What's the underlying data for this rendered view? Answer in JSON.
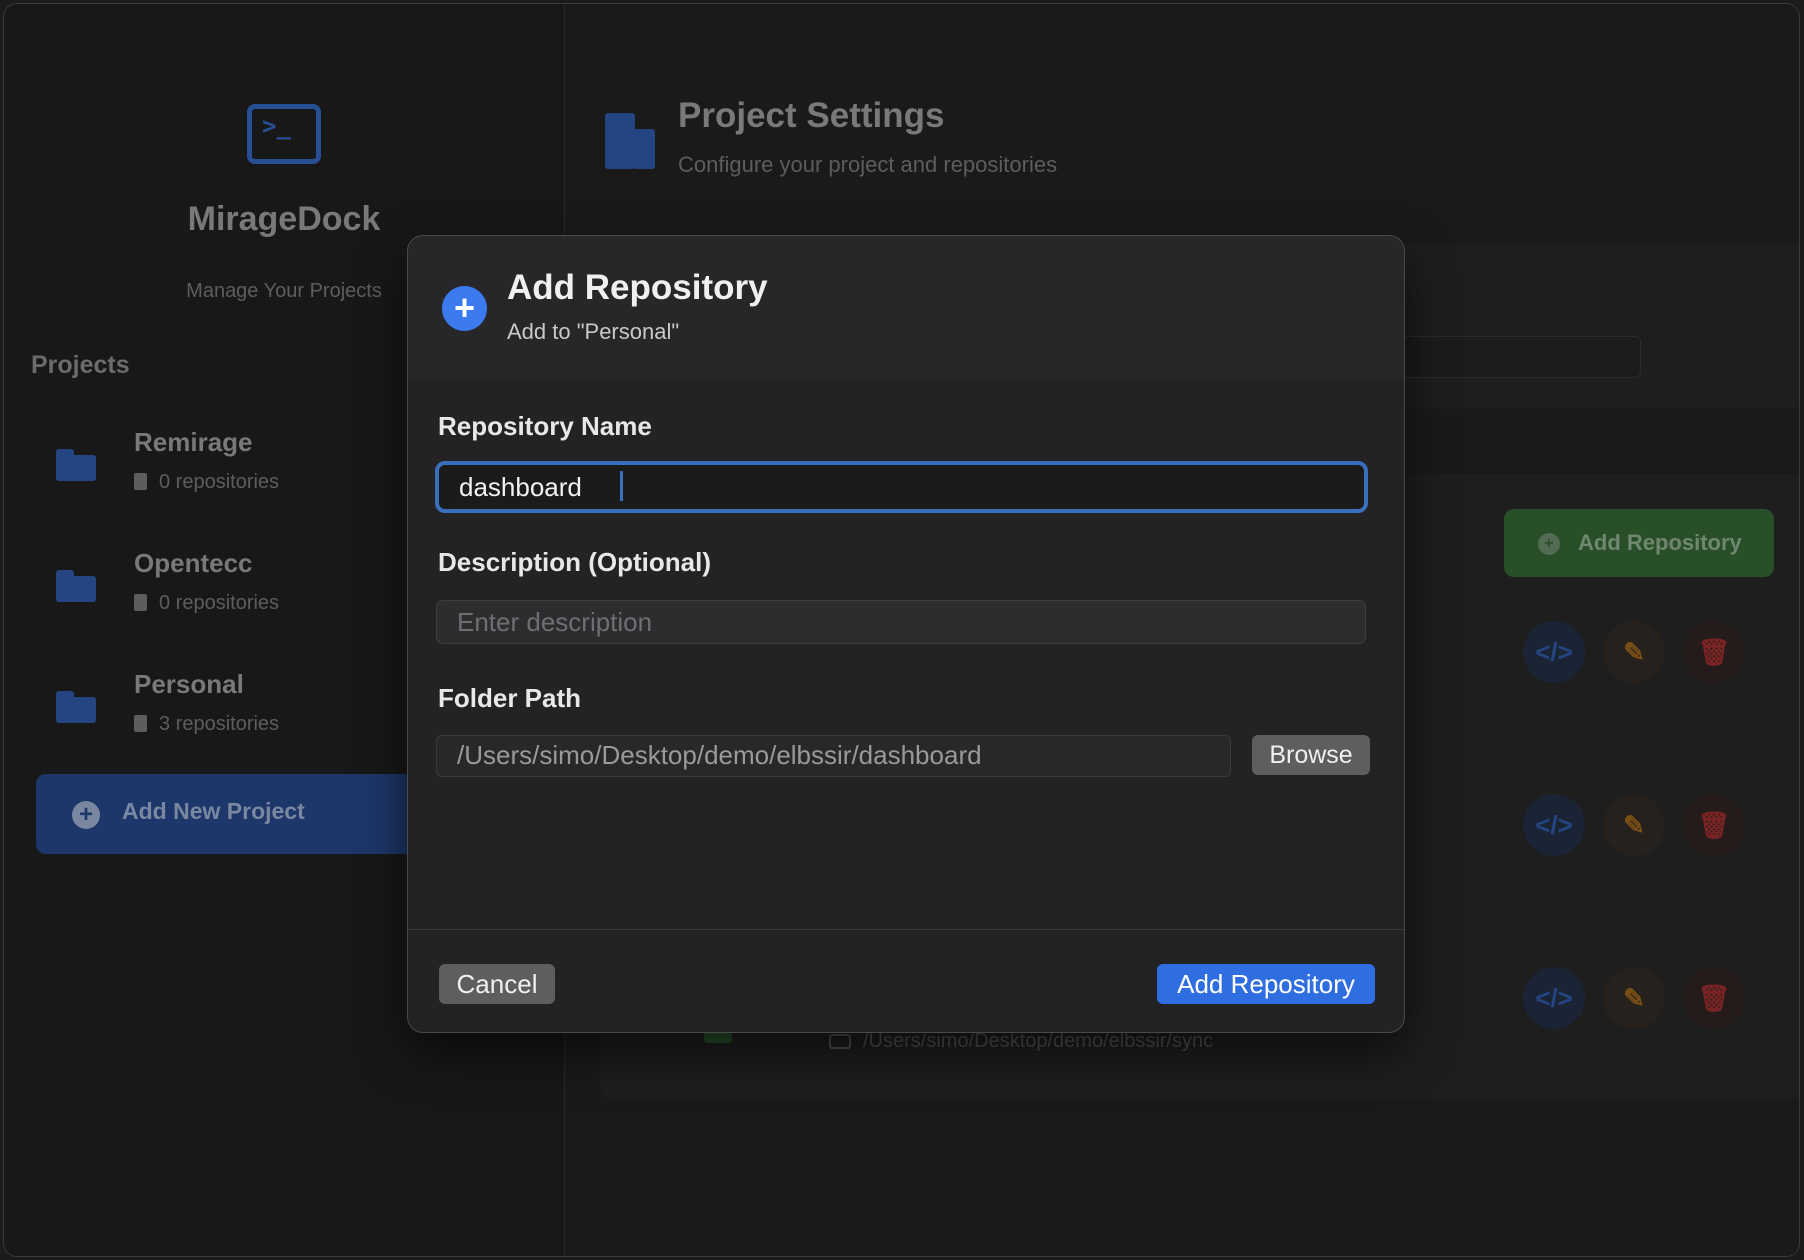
{
  "app": {
    "name": "MirageDock",
    "subtitle": "Manage Your Projects"
  },
  "sidebar": {
    "projects_title": "Projects",
    "projects": [
      {
        "name": "Remirage",
        "count": "0 repositories"
      },
      {
        "name": "Opentecc",
        "count": "0 repositories"
      },
      {
        "name": "Personal",
        "count": "3 repositories"
      }
    ],
    "add_project_label": "Add New Project"
  },
  "main": {
    "title": "Project Settings",
    "subtitle": "Configure your project and repositories",
    "add_repository_label": "Add Repository",
    "row_buttons": {
      "code": "</>",
      "edit": "✎",
      "delete": "🗑"
    },
    "visible_path": "/Users/simo/Desktop/demo/elbssir/sync"
  },
  "dialog": {
    "title": "Add Repository",
    "subtitle": "Add to \"Personal\"",
    "name_label": "Repository Name",
    "name_value": "dashboard",
    "description_label": "Description (Optional)",
    "description_placeholder": "Enter description",
    "folder_label": "Folder Path",
    "folder_value": "/Users/simo/Desktop/demo/elbssir/dashboard",
    "browse_label": "Browse",
    "cancel_label": "Cancel",
    "submit_label": "Add Repository"
  },
  "colors": {
    "accent": "#2f6ee0",
    "focus_ring": "#3a6fbd",
    "green": "#2f5a2f"
  }
}
